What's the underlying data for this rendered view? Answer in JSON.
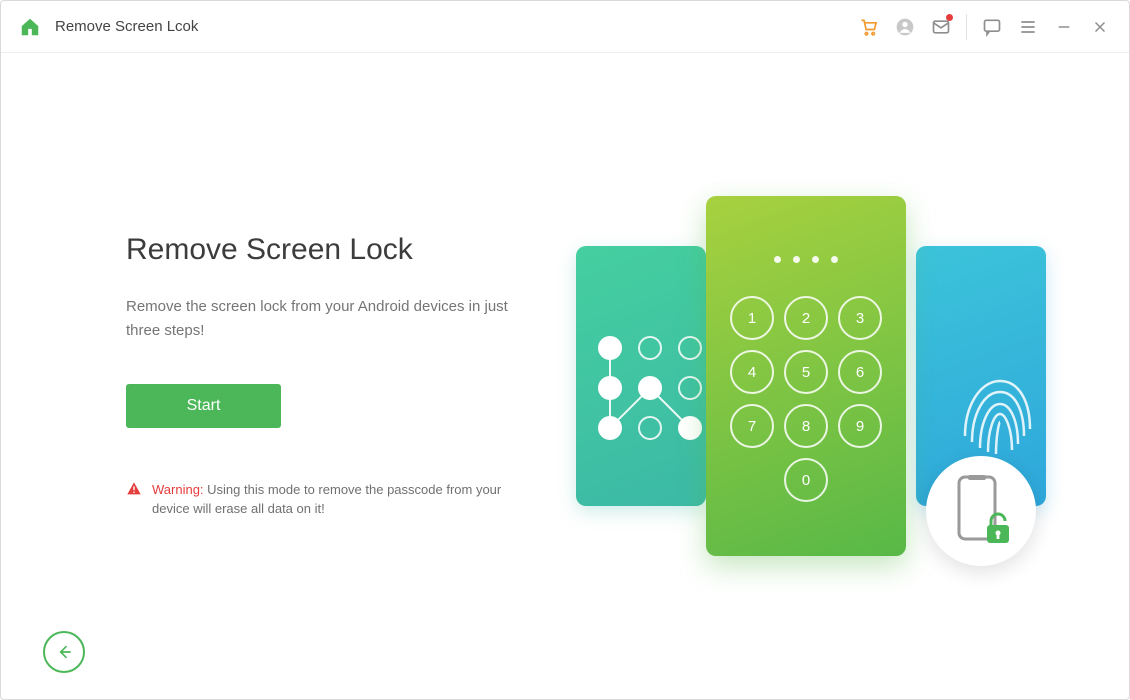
{
  "header": {
    "title": "Remove Screen Lcok"
  },
  "main": {
    "heading": "Remove Screen Lock",
    "description": "Remove the screen lock from your Android devices in just three steps!",
    "start_label": "Start",
    "warning_label": "Warning:",
    "warning_text": " Using this mode to remove the passcode from your device will erase all data on it!"
  },
  "keypad": {
    "digits": [
      "1",
      "2",
      "3",
      "4",
      "5",
      "6",
      "7",
      "8",
      "9",
      "0"
    ]
  },
  "colors": {
    "accent": "#4CB758",
    "cart": "#f29a2e",
    "danger": "#e53c3c"
  }
}
